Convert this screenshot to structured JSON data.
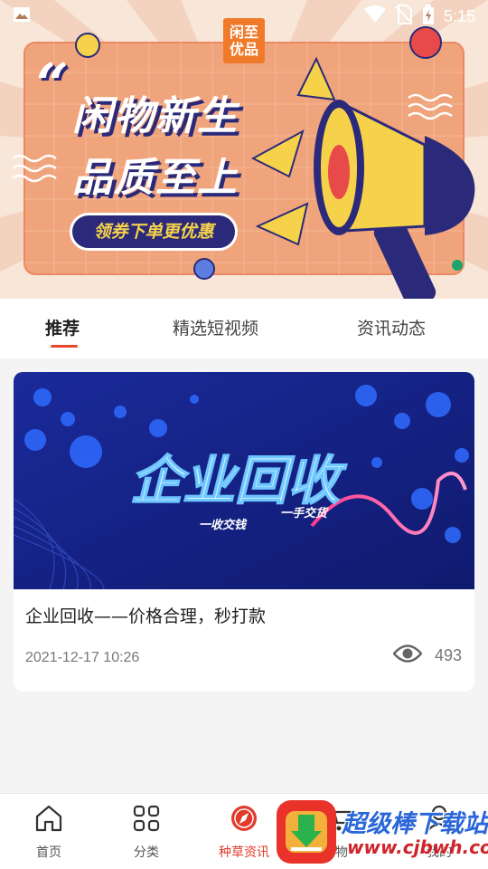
{
  "status_bar": {
    "time": "5:15",
    "icons": [
      "image-icon",
      "wifi-icon",
      "no-sim-icon",
      "battery-charging-icon"
    ]
  },
  "banner": {
    "logo_line1": "闲至",
    "logo_line2": "优品",
    "quote": "“",
    "title_line1": "闲物新生",
    "title_line2": "品质至上",
    "pill_text": "领券下单更优惠",
    "colors": {
      "bg": "#f6e1d2",
      "panel": "#f0a27a",
      "navy": "#2b2a7a",
      "yellow": "#f6d24a"
    }
  },
  "tabs": [
    {
      "label": "推荐",
      "active": true
    },
    {
      "label": "精选短视频",
      "active": false
    },
    {
      "label": "资讯动态",
      "active": false
    }
  ],
  "accent_color": "#e8472b",
  "feed": {
    "items": [
      {
        "image_heading": "企业回收",
        "image_sub_left": "一收交钱",
        "image_sub_right": "一手交货",
        "title": "企业回收——价格合理，秒打款",
        "date": "2021-12-17 10:26",
        "views": "493",
        "view_icon": "eye-icon"
      }
    ]
  },
  "bottom_nav": {
    "items": [
      {
        "label": "首页",
        "icon": "home-icon",
        "active": false
      },
      {
        "label": "分类",
        "icon": "grid-icon",
        "active": false
      },
      {
        "label": "种草资讯",
        "icon": "compass-icon",
        "active": true
      },
      {
        "label": "物",
        "icon": "cart-icon",
        "active": false
      },
      {
        "label": "我的",
        "icon": "user-icon",
        "active": false
      }
    ]
  },
  "watermark": {
    "text": "超级棒下载站",
    "url": "www.cjbwh.com"
  }
}
